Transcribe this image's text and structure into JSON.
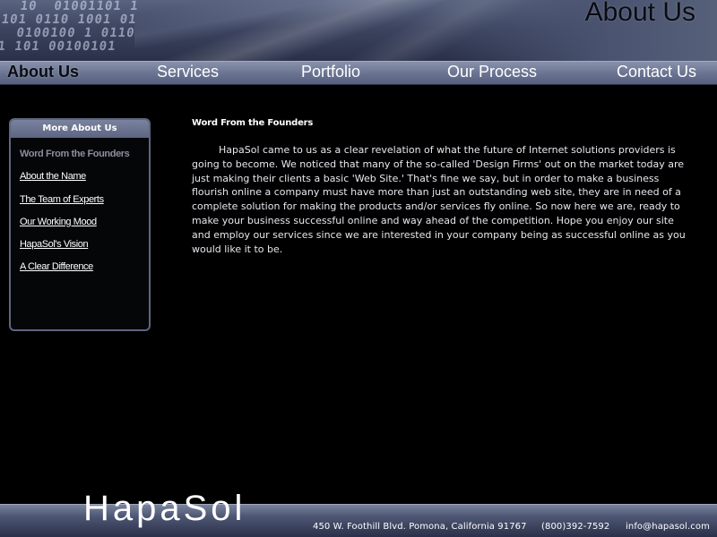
{
  "page_title": "About Us",
  "nav": {
    "items": [
      "About Us",
      "Services",
      "Portfolio",
      "Our Process",
      "Contact Us"
    ],
    "active": "About Us"
  },
  "sidebar": {
    "title": "More About Us",
    "items": [
      {
        "label": "Word From the Founders",
        "current": true
      },
      {
        "label": "About the Name",
        "current": false
      },
      {
        "label": "The Team of Experts",
        "current": false
      },
      {
        "label": "Our Working Mood",
        "current": false
      },
      {
        "label": "HapaSol's Vision",
        "current": false
      },
      {
        "label": "A Clear Difference",
        "current": false
      }
    ]
  },
  "main": {
    "heading": "Word From the Founders",
    "body": "HapaSol came to us as a clear revelation of what the future of Internet solutions providers is going to become. We noticed that many of the so-called 'Design Firms' out on the market today are just making their clients a basic 'Web Site.' That's fine we say, but in order to make a business flourish online a company must have more than just an outstanding web site, they are in need of a complete solution for making the products and/or services fly online. So now here we are, ready to make your business successful online and way ahead of the competition. Hope you enjoy our site and employ our services since we are interested in your company being as successful online as you would like it to be."
  },
  "footer": {
    "brand": "HapaSol",
    "address": "450 W. Foothill Blvd. Pomona, California 91767",
    "phone": "(800)392-7592",
    "email": "info@hapasol.com"
  },
  "colors": {
    "background": "#000000",
    "nav_bar": "#6c7693",
    "panel_border": "#5d667f",
    "inactive_sidebar_text": "#8a8f9c"
  }
}
